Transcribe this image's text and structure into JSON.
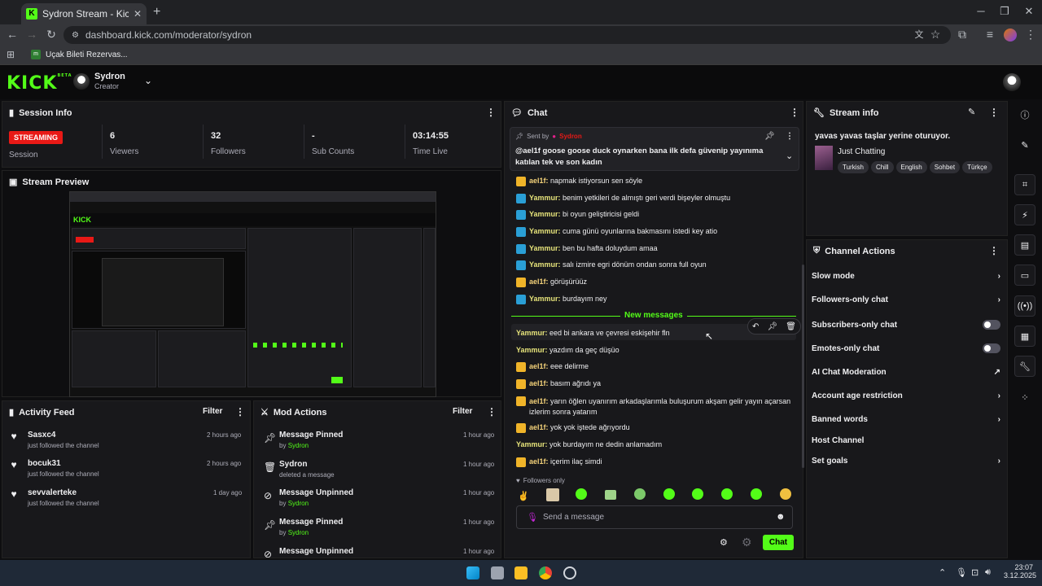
{
  "browser": {
    "tab_title": "Sydron Stream - Kick Dashboard",
    "tab_close": "✕",
    "new_tab": "+",
    "url": "dashboard.kick.com/moderator/sydron",
    "bookmark": "Uçak Bileti Rezervas..."
  },
  "header": {
    "logo": "KICK",
    "logo_beta": "BETA",
    "username": "Sydron",
    "role": "Creator"
  },
  "session": {
    "title": "Session Info",
    "status_badge": "STREAMING",
    "status_label": "Session",
    "viewers_value": "6",
    "viewers_label": "Viewers",
    "followers_value": "32",
    "followers_label": "Followers",
    "subs_value": "-",
    "subs_label": "Sub Counts",
    "time_value": "03:14:55",
    "time_label": "Time Live"
  },
  "preview": {
    "title": "Stream Preview"
  },
  "activity": {
    "title": "Activity Feed",
    "filter": "Filter",
    "items": [
      {
        "name": "Sasxc4",
        "sub": "just followed the channel",
        "time": "2 hours ago"
      },
      {
        "name": "bocuk31",
        "sub": "just followed the channel",
        "time": "2 hours ago"
      },
      {
        "name": "sevvalerteke",
        "sub": "just followed the channel",
        "time": "1 day ago"
      }
    ]
  },
  "mod": {
    "title": "Mod Actions",
    "filter": "Filter",
    "items": [
      {
        "title": "Message Pinned",
        "by": "by",
        "who": "Sydron",
        "time": "1 hour ago"
      },
      {
        "title": "Sydron",
        "by": "deleted a message",
        "who": "",
        "time": "1 hour ago"
      },
      {
        "title": "Message Unpinned",
        "by": "by",
        "who": "Sydron",
        "time": "1 hour ago"
      },
      {
        "title": "Message Pinned",
        "by": "by",
        "who": "Sydron",
        "time": "1 hour ago"
      },
      {
        "title": "Message Unpinned",
        "by": "",
        "who": "",
        "time": "1 hour ago"
      }
    ]
  },
  "chat": {
    "title": "Chat",
    "pinned_sent_by": "Sent by",
    "pinned_user": "Sydron",
    "pinned_text": "@ael1f goose goose duck oynarken bana ilk defa güvenip yayınıma katılan tek ve son kadın",
    "messages": [
      {
        "badge": "crown",
        "user": "ael1f:",
        "text": "napmak istiyorsun sen söyle"
      },
      {
        "badge": "arrow",
        "user": "Yammur:",
        "text": "benim yetkileri de almıştı geri verdi bişeyler olmuştu"
      },
      {
        "badge": "arrow",
        "user": "Yammur:",
        "text": "bi oyun geliştiricisi geldi"
      },
      {
        "badge": "arrow",
        "user": "Yammur:",
        "text": "cuma günü oyunlarına bakmasını istedi key atio"
      },
      {
        "badge": "arrow",
        "user": "Yammur:",
        "text": "ben bu hafta doluydum amaa"
      },
      {
        "badge": "arrow",
        "user": "Yammur:",
        "text": "salı izmire egri dönüm ondan sonra full oyun"
      },
      {
        "badge": "crown",
        "user": "ael1f:",
        "text": "görüşürüüz"
      },
      {
        "badge": "arrow",
        "user": "Yammur:",
        "text": "burdayım ney"
      }
    ],
    "new_messages": "New messages",
    "new": [
      {
        "badge": "",
        "user": "Yammur:",
        "text": "eed bi ankara ve çevresi eskişehir fln"
      },
      {
        "badge": "",
        "user": "Yammur:",
        "text": "yazdım da geç düşüo"
      },
      {
        "badge": "crown",
        "user": "ael1f:",
        "text": "eee delirme"
      },
      {
        "badge": "crown",
        "user": "ael1f:",
        "text": "basım ağrıdı ya"
      },
      {
        "badge": "crown",
        "user": "ael1f:",
        "text": "yarın öğlen uyanırım arkadaşlarımla buluşurum akşam gelir yayın açarsan izlerim sonra yatarım"
      },
      {
        "badge": "crown",
        "user": "ael1f:",
        "text": "yok yok iştede ağrıyordu"
      },
      {
        "badge": "",
        "user": "Yammur:",
        "text": "yok burdayım ne dedin anlamadım"
      },
      {
        "badge": "crown",
        "user": "ael1f:",
        "text": "içerim ilaç simdi"
      }
    ],
    "followers_only": "Followers only",
    "placeholder": "Send a message",
    "send": "Chat"
  },
  "stream_info": {
    "title": "Stream info",
    "stream_title": "yavas yavas taşlar yerine oturuyor.",
    "category": "Just Chatting",
    "tags": [
      "Turkish",
      "Chill",
      "English",
      "Sohbet",
      "Türkçe"
    ]
  },
  "channel_actions": {
    "title": "Channel Actions",
    "items": [
      {
        "label": "Slow mode",
        "control": "chevron"
      },
      {
        "label": "Followers-only chat",
        "control": "chevron"
      },
      {
        "label": "Subscribers-only chat",
        "control": "toggle"
      },
      {
        "label": "Emotes-only chat",
        "control": "toggle"
      },
      {
        "label": "AI Chat Moderation",
        "control": "external"
      },
      {
        "label": "Account age restriction",
        "control": "chevron"
      },
      {
        "label": "Banned words",
        "control": "chevron"
      },
      {
        "label": "Host Channel",
        "control": "none"
      },
      {
        "label": "Set goals",
        "control": "chevron"
      }
    ]
  },
  "taskbar": {
    "time": "23:07",
    "date": "3.12.2025"
  },
  "colors": {
    "accent": "#53fc18",
    "live": "#e91916",
    "panel": "#18181b",
    "bg": "#0e0e10"
  }
}
